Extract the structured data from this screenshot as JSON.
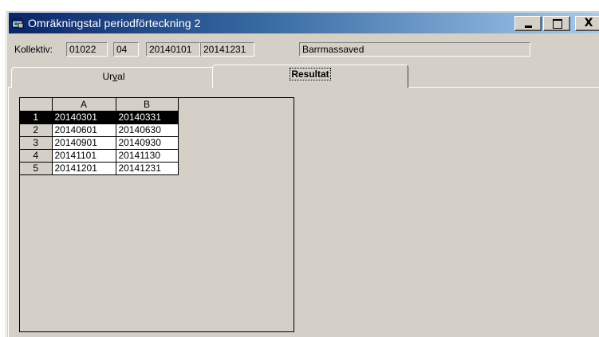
{
  "window": {
    "title": "Omräkningstal periodförteckning 2",
    "controls": {
      "minimize": "_",
      "maximize": "□",
      "close": "X"
    }
  },
  "header": {
    "kollektiv_label": "Kollektiv:",
    "kollektiv_code": "01022",
    "kollektiv_sub": "04",
    "date_from": "20140101",
    "date_to": "20141231",
    "description": "Barrmassaved"
  },
  "tabs": [
    {
      "label_prefix": "Ur",
      "label_underline": "v",
      "label_suffix": "al",
      "active": false
    },
    {
      "label": "Resultat",
      "active": true
    }
  ],
  "grid": {
    "columns": [
      "A",
      "B"
    ],
    "rows": [
      {
        "num": "1",
        "a": "20140301",
        "b": "20140331",
        "selected": true
      },
      {
        "num": "2",
        "a": "20140601",
        "b": "20140630",
        "selected": false
      },
      {
        "num": "3",
        "a": "20140901",
        "b": "20140930",
        "selected": false
      },
      {
        "num": "4",
        "a": "20141101",
        "b": "20141130",
        "selected": false
      },
      {
        "num": "5",
        "a": "20141201",
        "b": "20141231",
        "selected": false
      }
    ]
  }
}
